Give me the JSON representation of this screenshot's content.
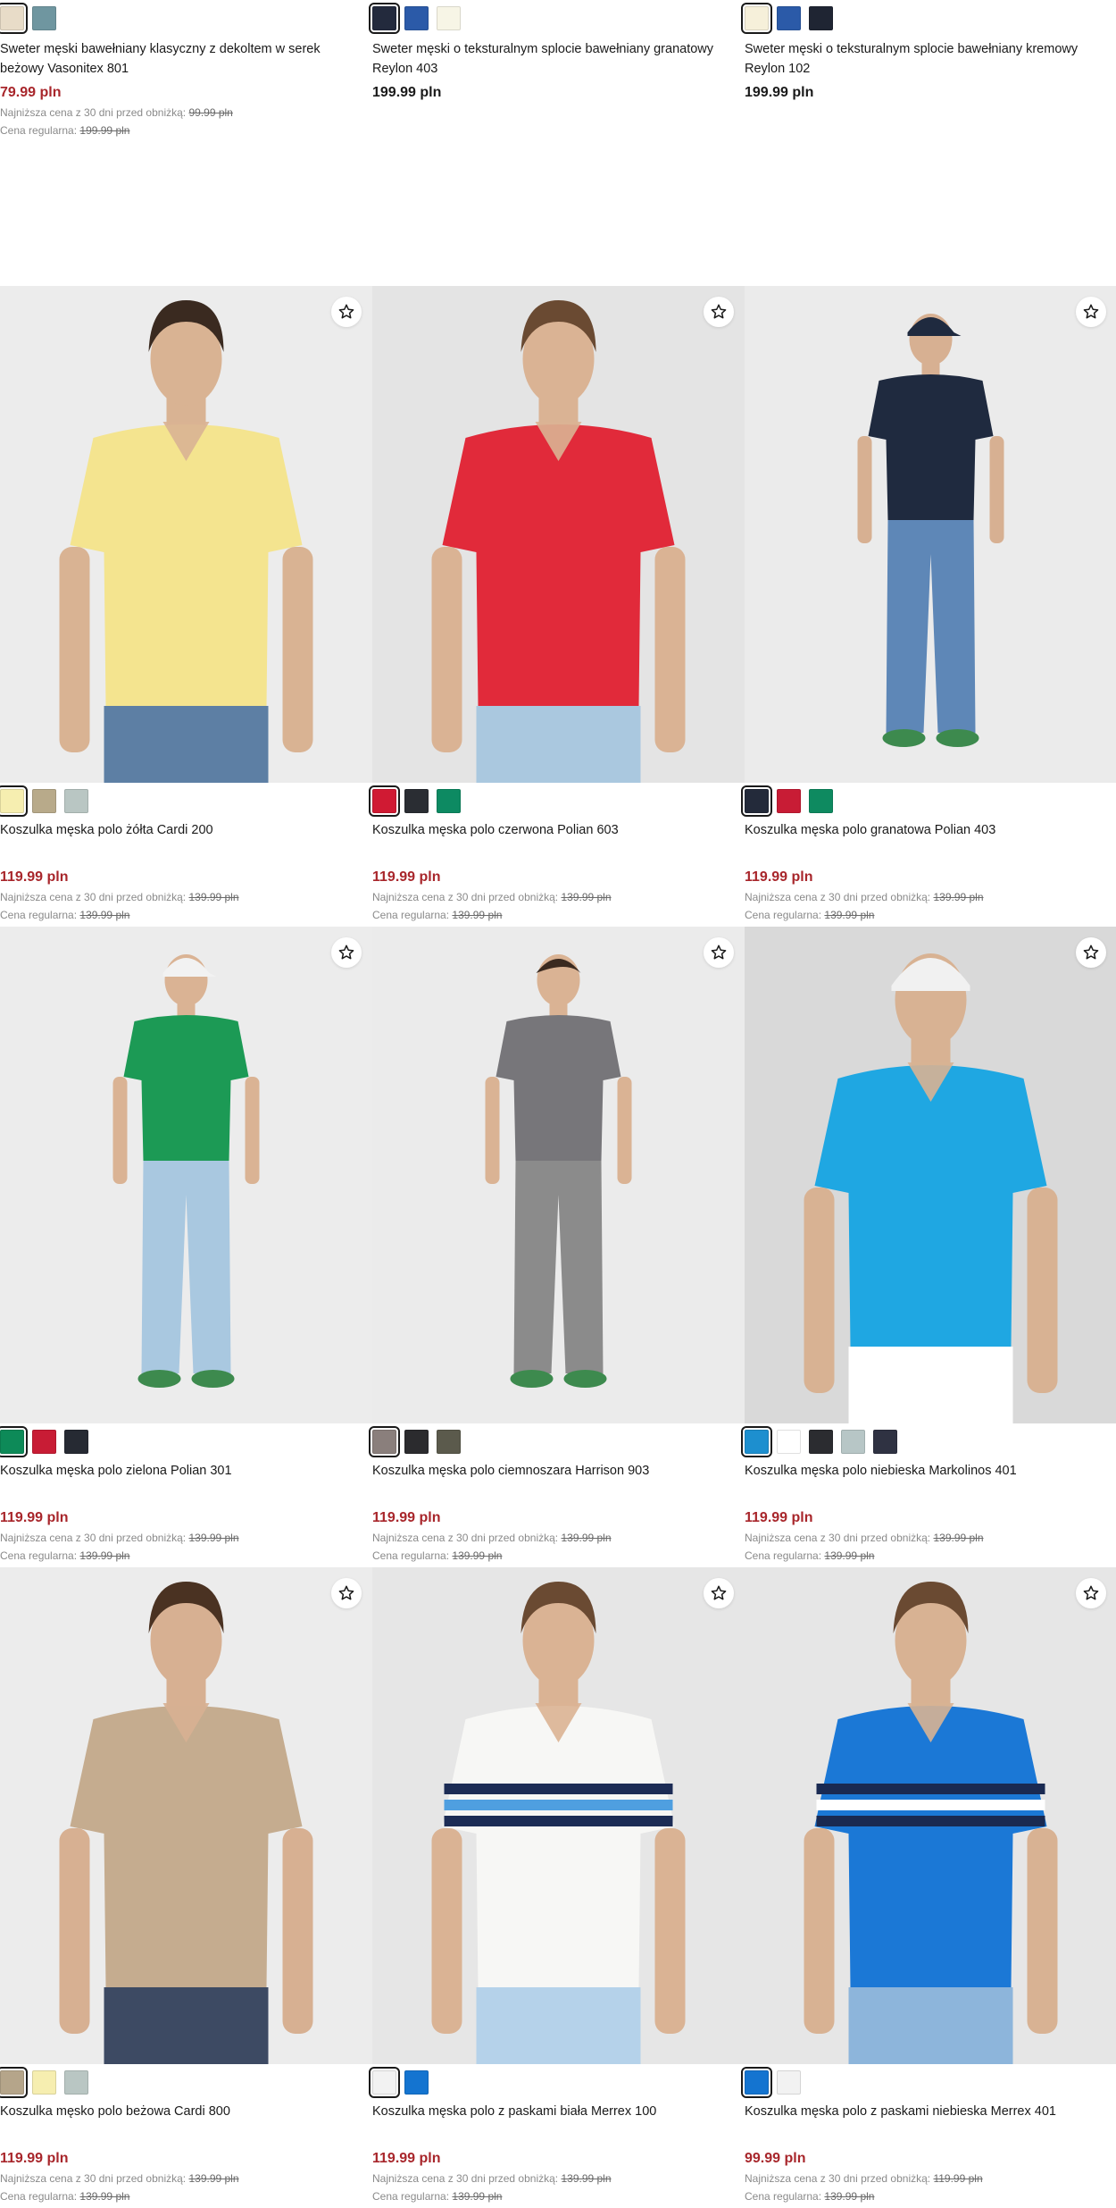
{
  "labels": {
    "lowest_price_label": "Najniższa cena z 30 dni przed obniżką:",
    "regular_price_label": "Cena regularna:"
  },
  "top_products": [
    {
      "name": "Sweter męski bawełniany klasyczny z dekoltem w serek beżowy Vasonitex 801",
      "price": "79.99 pln",
      "on_sale": true,
      "lowest_price": "99.99 pln",
      "regular_price": "199.99 pln",
      "swatches": [
        "#e8dcc8",
        "#6f96a0"
      ],
      "selected_swatch": 0
    },
    {
      "name": "Sweter męski o teksturalnym splocie bawełniany granatowy Reylon 403",
      "price": "199.99 pln",
      "on_sale": false,
      "swatches": [
        "#232a3d",
        "#2b5aa8",
        "#f7f5e6"
      ],
      "selected_swatch": 0
    },
    {
      "name": "Sweter męski o teksturalnym splocie bawełniany kremowy Reylon 102",
      "price": "199.99 pln",
      "on_sale": false,
      "swatches": [
        "#f6f0da",
        "#2b5aa8",
        "#1f2533"
      ],
      "selected_swatch": 0
    }
  ],
  "products": [
    {
      "name": "Koszulka męska polo żółta Cardi 200",
      "price": "119.99 pln",
      "lowest_price": "139.99 pln",
      "regular_price": "139.99 pln",
      "swatches": [
        "#f6eeb0",
        "#b8aa8a",
        "#b9c6c3"
      ],
      "selected_swatch": 0,
      "photo": {
        "bg": "#ececec",
        "shirt": "#f4e48f",
        "trousers": "#5d7fa4",
        "skin": "#d9b393",
        "hair": "#3a2a20",
        "full_body": false,
        "cap": ""
      }
    },
    {
      "name": "Koszulka męska polo czerwona Polian 603",
      "price": "119.99 pln",
      "lowest_price": "139.99 pln",
      "regular_price": "139.99 pln",
      "swatches": [
        "#d01a33",
        "#2a2d33",
        "#0d8a62"
      ],
      "selected_swatch": 0,
      "photo": {
        "bg": "#e4e4e4",
        "shirt": "#e12a3a",
        "trousers": "#aac8df",
        "skin": "#dab394",
        "hair": "#6a4a32",
        "full_body": false,
        "cap": ""
      }
    },
    {
      "name": "Koszulka męska polo granatowa Polian 403",
      "price": "119.99 pln",
      "lowest_price": "139.99 pln",
      "regular_price": "139.99 pln",
      "swatches": [
        "#232a3a",
        "#c81c35",
        "#0e8a60"
      ],
      "selected_swatch": 0,
      "photo": {
        "bg": "#ebebeb",
        "shirt": "#1f2a3f",
        "trousers": "#5e87b7",
        "skin": "#d7b092",
        "hair": "#3b2a20",
        "full_body": true,
        "cap": "#1f2a3f"
      }
    },
    {
      "name": "Koszulka męska polo zielona Polian 301",
      "price": "119.99 pln",
      "lowest_price": "139.99 pln",
      "regular_price": "139.99 pln",
      "swatches": [
        "#0d8a58",
        "#c81c35",
        "#262a33"
      ],
      "selected_swatch": 0,
      "photo": {
        "bg": "#ececec",
        "shirt": "#1c9a55",
        "trousers": "#a9c8e0",
        "skin": "#dab394",
        "hair": "#3a2a20",
        "full_body": true,
        "cap": "#f2f2f2"
      }
    },
    {
      "name": "Koszulka męska polo ciemnoszara Harrison 903",
      "price": "119.99 pln",
      "lowest_price": "139.99 pln",
      "regular_price": "139.99 pln",
      "swatches": [
        "#8a7f7c",
        "#2b2b2e",
        "#5b5a4c"
      ],
      "selected_swatch": 0,
      "photo": {
        "bg": "#ebebeb",
        "shirt": "#77767a",
        "trousers": "#8b8b8b",
        "skin": "#dab394",
        "hair": "#3a2a20",
        "full_body": true,
        "cap": ""
      }
    },
    {
      "name": "Koszulka męska polo niebieska Markolinos 401",
      "price": "119.99 pln",
      "lowest_price": "139.99 pln",
      "regular_price": "139.99 pln",
      "swatches": [
        "#1d8fcf",
        "#ffffff",
        "#2b2c30",
        "#b7c6c6",
        "#2f3242"
      ],
      "selected_swatch": 0,
      "photo": {
        "bg": "#d9d9d9",
        "shirt": "#1fa7e2",
        "trousers": "#ffffff",
        "skin": "#d8b293",
        "hair": "#5a3f2a",
        "full_body": false,
        "cap": "#f1f1f1"
      }
    },
    {
      "name": "Koszulka męsko polo beżowa Cardi 800",
      "price": "119.99 pln",
      "lowest_price": "139.99 pln",
      "regular_price": "139.99 pln",
      "swatches": [
        "#b5a58a",
        "#f6eeb0",
        "#b9c6c3"
      ],
      "selected_swatch": 0,
      "photo": {
        "bg": "#ececec",
        "shirt": "#c5ac8f",
        "trousers": "#3d4a63",
        "skin": "#d7b092",
        "hair": "#4a3222",
        "full_body": false,
        "cap": ""
      }
    },
    {
      "name": "Koszulka męska polo z paskami biała Merrex 100",
      "price": "119.99 pln",
      "lowest_price": "139.99 pln",
      "regular_price": "139.99 pln",
      "swatches": [
        "#f2f2f2",
        "#1474d0"
      ],
      "selected_swatch": 0,
      "photo": {
        "bg": "#e6e6e6",
        "shirt": "#f7f7f5",
        "trousers": "#b5d2ea",
        "skin": "#dab394",
        "hair": "#6a4a32",
        "full_body": false,
        "cap": "",
        "stripes": [
          "#1c2c55",
          "#4f9fe0",
          "#1c2c55"
        ]
      }
    },
    {
      "name": "Koszulka męska polo z paskami niebieska Merrex 401",
      "price": "99.99 pln",
      "lowest_price": "119.99 pln",
      "regular_price": "139.99 pln",
      "swatches": [
        "#1474d0",
        "#f2f2f2"
      ],
      "selected_swatch": 0,
      "photo": {
        "bg": "#e6e6e6",
        "shirt": "#1b78d6",
        "trousers": "#8db5db",
        "skin": "#d8b293",
        "hair": "#6a4a32",
        "full_body": false,
        "cap": "",
        "stripes": [
          "#1a2a52",
          "#ffffff",
          "#1a2a52"
        ]
      }
    }
  ]
}
